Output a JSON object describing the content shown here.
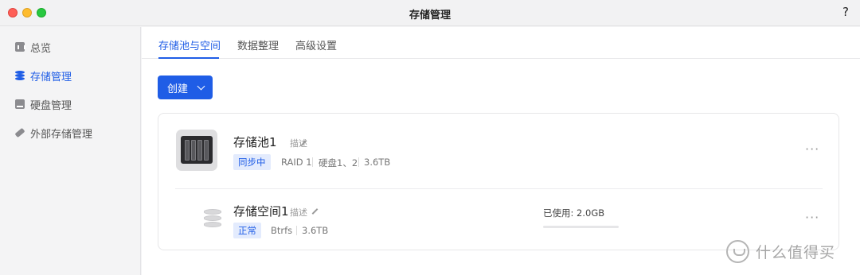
{
  "window": {
    "title": "存储管理",
    "help": "?"
  },
  "sidebar": {
    "items": [
      {
        "label": "总览",
        "icon": "overview-icon"
      },
      {
        "label": "存储管理",
        "icon": "database-icon",
        "active": true
      },
      {
        "label": "硬盘管理",
        "icon": "hard-disk-icon"
      },
      {
        "label": "外部存储管理",
        "icon": "usb-drive-icon"
      }
    ]
  },
  "tabs": [
    {
      "label": "存储池与空间",
      "active": true
    },
    {
      "label": "数据整理"
    },
    {
      "label": "高级设置"
    }
  ],
  "toolbar": {
    "create_label": "创建"
  },
  "pool": {
    "name": "存储池1",
    "desc": "描述",
    "status": "同步中",
    "raid": "RAID 1",
    "disks": "硬盘1、2",
    "size": "3.6TB",
    "more": "···"
  },
  "volume": {
    "name": "存储空间1",
    "desc": "描述",
    "status": "正常",
    "fs": "Btrfs",
    "size": "3.6TB",
    "usage_text": "已使用: 2.0GB",
    "usage_fraction": 0.0005,
    "more": "···"
  },
  "watermark": {
    "text": "什么值得买"
  },
  "colors": {
    "accent": "#1f5de6",
    "badge_bg": "#e3ebfd"
  }
}
